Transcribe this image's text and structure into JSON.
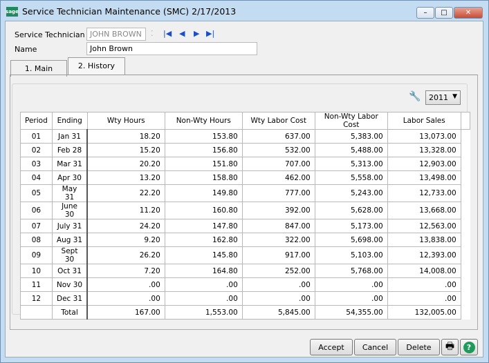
{
  "window": {
    "title": "Service Technician Maintenance (SMC) 2/17/2013",
    "logo": "sage",
    "minimize": "–",
    "maximize": "□",
    "close": "✕"
  },
  "form": {
    "tech_label": "Service Technician",
    "tech_value": "JOHN BROWN",
    "name_label": "Name",
    "name_value": "John Brown"
  },
  "tabs": [
    {
      "label": "1. Main"
    },
    {
      "label": "2. History"
    }
  ],
  "year": "2011",
  "table": {
    "headers": [
      "Period",
      "Ending",
      "Wty Hours",
      "Non-Wty Hours",
      "Wty Labor Cost",
      "Non-Wty Labor Cost",
      "Labor Sales"
    ],
    "rows": [
      [
        "01",
        "Jan 31",
        "18.20",
        "153.80",
        "637.00",
        "5,383.00",
        "13,073.00"
      ],
      [
        "02",
        "Feb 28",
        "15.20",
        "156.80",
        "532.00",
        "5,488.00",
        "13,328.00"
      ],
      [
        "03",
        "Mar 31",
        "20.20",
        "151.80",
        "707.00",
        "5,313.00",
        "12,903.00"
      ],
      [
        "04",
        "Apr 30",
        "13.20",
        "158.80",
        "462.00",
        "5,558.00",
        "13,498.00"
      ],
      [
        "05",
        "May 31",
        "22.20",
        "149.80",
        "777.00",
        "5,243.00",
        "12,733.00"
      ],
      [
        "06",
        "June 30",
        "11.20",
        "160.80",
        "392.00",
        "5,628.00",
        "13,668.00"
      ],
      [
        "07",
        "July 31",
        "24.20",
        "147.80",
        "847.00",
        "5,173.00",
        "12,563.00"
      ],
      [
        "08",
        "Aug 31",
        "9.20",
        "162.80",
        "322.00",
        "5,698.00",
        "13,838.00"
      ],
      [
        "09",
        "Sept 30",
        "26.20",
        "145.80",
        "917.00",
        "5,103.00",
        "12,393.00"
      ],
      [
        "10",
        "Oct 31",
        "7.20",
        "164.80",
        "252.00",
        "5,768.00",
        "14,008.00"
      ],
      [
        "11",
        "Nov 30",
        ".00",
        ".00",
        ".00",
        ".00",
        ".00"
      ],
      [
        "12",
        "Dec 31",
        ".00",
        ".00",
        ".00",
        ".00",
        ".00"
      ],
      [
        "",
        "Total",
        "167.00",
        "1,553.00",
        "5,845.00",
        "54,355.00",
        "132,005.00"
      ]
    ]
  },
  "buttons": {
    "accept": "Accept",
    "cancel": "Cancel",
    "delete": "Delete"
  }
}
